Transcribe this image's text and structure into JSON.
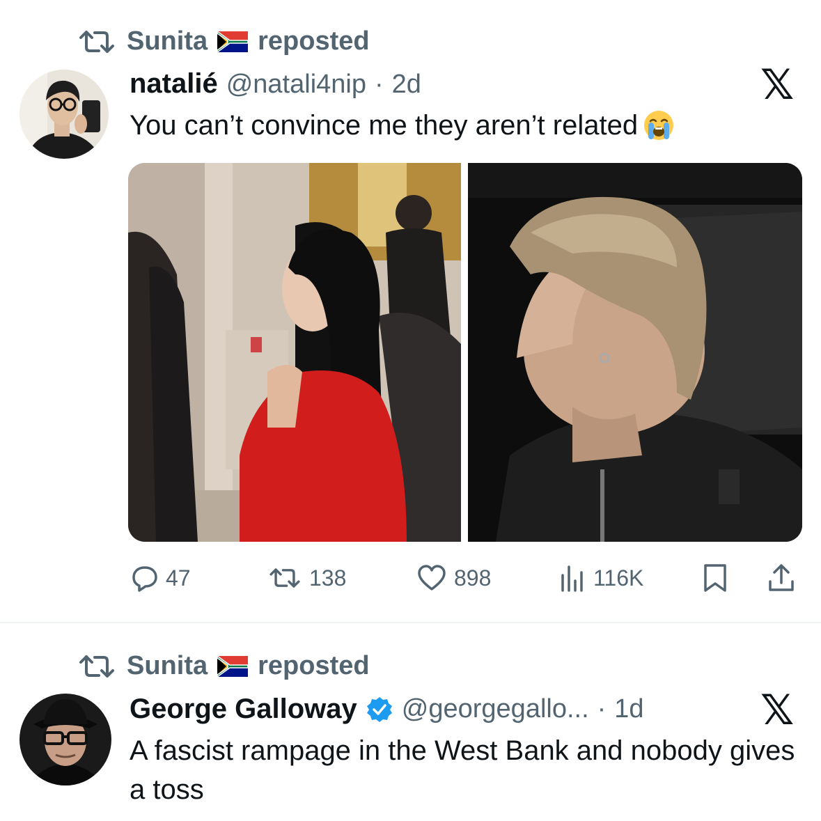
{
  "tweets": [
    {
      "reposter": "Sunita",
      "reposted_label": "reposted",
      "author_name": "natalié",
      "author_handle": "@natali4nip",
      "separator": "·",
      "time": "2d",
      "text": "You can’t convince me they aren’t related",
      "stats": {
        "replies": "47",
        "reposts": "138",
        "likes": "898",
        "views": "116K"
      }
    },
    {
      "reposter": "Sunita",
      "reposted_label": "reposted",
      "author_name": "George Galloway",
      "author_handle": "@georgegallo...",
      "separator": "·",
      "time": "1d",
      "text": "A fascist rampage in the West Bank and nobody gives a toss"
    }
  ],
  "icons": {
    "repost": "repost-icon",
    "flag": "south-africa-flag-icon",
    "close": "x-logo-icon",
    "reply": "reply-icon",
    "like": "heart-icon",
    "views": "views-icon",
    "bookmark": "bookmark-icon",
    "share": "share-icon",
    "verified": "verified-badge-icon",
    "emoji": "crying-face-emoji-icon"
  },
  "colors": {
    "secondary_text": "#536471",
    "primary_text": "#0f1419",
    "verified": "#1d9bf0",
    "divider": "#eff3f4"
  }
}
